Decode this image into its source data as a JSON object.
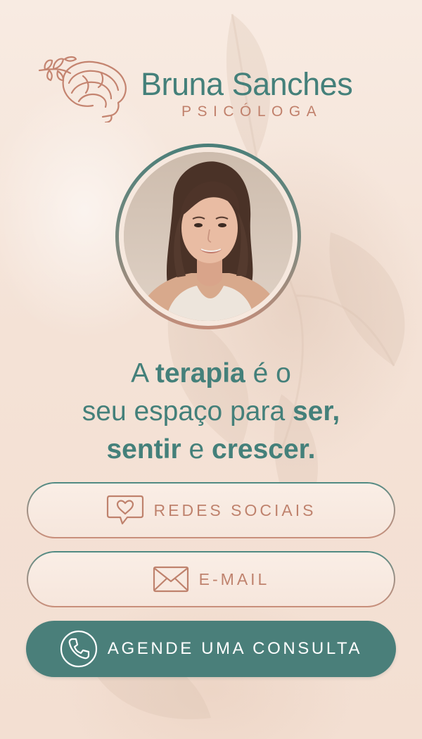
{
  "brand": {
    "name": "Bruna Sanches",
    "title": "PSICÓLOGA",
    "logo_icon": "brain-leaf-icon"
  },
  "tagline": {
    "line1": [
      {
        "text": "A ",
        "bold": false
      },
      {
        "text": "terapia",
        "bold": true
      },
      {
        "text": " é o",
        "bold": false
      }
    ],
    "line2": [
      {
        "text": "seu espaço para ",
        "bold": false
      },
      {
        "text": "ser,",
        "bold": true
      }
    ],
    "line3": [
      {
        "text": "sentir",
        "bold": true
      },
      {
        "text": " e ",
        "bold": false
      },
      {
        "text": "crescer.",
        "bold": true
      }
    ]
  },
  "buttons": {
    "social": {
      "label": "REDES SOCIAIS",
      "icon": "chat-heart-icon"
    },
    "email": {
      "label": "E-MAIL",
      "icon": "envelope-icon"
    },
    "schedule": {
      "label": "AGENDE UMA CONSULTA",
      "icon": "phone-icon"
    }
  },
  "colors": {
    "teal": "#44807a",
    "rose": "#c0806b",
    "background": "#f6e6dc",
    "primary_button": "#4a7f7a"
  }
}
